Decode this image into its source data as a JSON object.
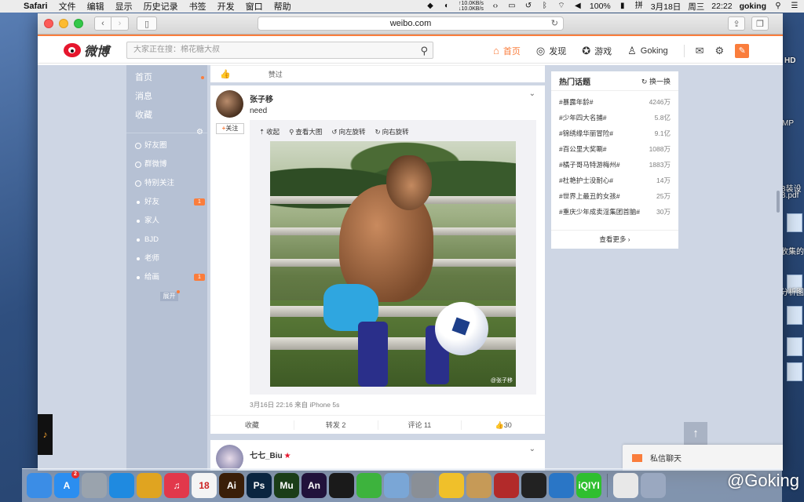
{
  "menubar": {
    "app": "Safari",
    "items": [
      "文件",
      "编辑",
      "显示",
      "历史记录",
      "书签",
      "开发",
      "窗口",
      "帮助"
    ],
    "net_up": "10.0KB/s",
    "net_down": "10.0KB/s",
    "battery": "100%",
    "date": "3月18日",
    "weekday": "周三",
    "time": "22:22",
    "user": "goking"
  },
  "browser": {
    "url": "weibo.com"
  },
  "weibo": {
    "logo_text": "微博",
    "search_placeholder": "大家正在搜：棉花糖大叔",
    "nav": [
      {
        "label": "首页",
        "icon": "home-icon"
      },
      {
        "label": "发现",
        "icon": "compass-icon"
      },
      {
        "label": "游戏",
        "icon": "game-icon"
      },
      {
        "label": "Goking",
        "icon": "user-icon"
      }
    ]
  },
  "left_nav": {
    "main": [
      "首页",
      "消息",
      "收藏"
    ],
    "groups": [
      {
        "label": "好友圈",
        "badge": ""
      },
      {
        "label": "群微博",
        "badge": ""
      },
      {
        "label": "特别关注",
        "badge": ""
      },
      {
        "label": "好友",
        "badge": "1"
      },
      {
        "label": "家人",
        "badge": ""
      },
      {
        "label": "BJD",
        "badge": ""
      },
      {
        "label": "老师",
        "badge": ""
      },
      {
        "label": "给画",
        "badge": "1"
      }
    ],
    "expand": "展开"
  },
  "feed": {
    "prev_like_label": "赞过",
    "post": {
      "author": "张子移",
      "text": "need",
      "follow_label": "关注",
      "tools": [
        "收起",
        "查看大图",
        "向左旋转",
        "向右旋转"
      ],
      "watermark": "@张子移",
      "meta": "3月16日 22:16 来自 iPhone 5s",
      "actions": {
        "collect": "收藏",
        "repost": "转发 2",
        "comment": "评论 11",
        "like": "30"
      }
    },
    "next_post": {
      "author": "七七_Biu"
    }
  },
  "hot_topics": {
    "title": "热门话题",
    "refresh": "换一换",
    "items": [
      {
        "topic": "#暴露年龄#",
        "count": "4246万"
      },
      {
        "topic": "#少年四大名捕#",
        "count": "5.8亿"
      },
      {
        "topic": "#锦绣缘华丽冒险#",
        "count": "9.1亿"
      },
      {
        "topic": "#百公里大奖唰#",
        "count": "1088万"
      },
      {
        "topic": "#橘子哥马特游梅州#",
        "count": "1883万"
      },
      {
        "topic": "#杜艳护士没耐心#",
        "count": "14万"
      },
      {
        "topic": "#世界上最丑的女孩#",
        "count": "25万"
      },
      {
        "topic": "#重庆少年成卖淫集团首脑#",
        "count": "30万"
      }
    ],
    "more": "查看更多"
  },
  "chat": {
    "label": "私信聊天"
  },
  "desktop": {
    "labels": [
      "HD",
      "MP",
      "B装设",
      "B.pdf",
      "收集的",
      "分析图"
    ],
    "watermark": "@Goking"
  },
  "dock": {
    "apps": [
      {
        "name": "finder-icon",
        "label": "",
        "color": "#3b8de6"
      },
      {
        "name": "app-store-icon",
        "label": "A",
        "color": "#2b8ef0",
        "badge": "2"
      },
      {
        "name": "launchpad-icon",
        "label": "",
        "color": "#9aa3ad"
      },
      {
        "name": "safari-icon",
        "label": "",
        "color": "#1f8ae0"
      },
      {
        "name": "chrome-icon",
        "label": "",
        "color": "#e0a420"
      },
      {
        "name": "itunes-icon",
        "label": "♫",
        "color": "#e2384b"
      },
      {
        "name": "calendar-icon",
        "label": "18",
        "color": "#f4f4f4"
      },
      {
        "name": "illustrator-icon",
        "label": "Ai",
        "color": "#3a1e08"
      },
      {
        "name": "photoshop-icon",
        "label": "Ps",
        "color": "#0a2540"
      },
      {
        "name": "muse-icon",
        "label": "Mu",
        "color": "#1b3d18"
      },
      {
        "name": "animate-icon",
        "label": "An",
        "color": "#21123b"
      },
      {
        "name": "qq-icon",
        "label": "",
        "color": "#1a1a1a"
      },
      {
        "name": "wechat-icon",
        "label": "",
        "color": "#3db33d"
      },
      {
        "name": "preview-icon",
        "label": "",
        "color": "#7aa6d6"
      },
      {
        "name": "system-preferences-icon",
        "label": "",
        "color": "#8a8f96"
      },
      {
        "name": "photos-icon",
        "label": "",
        "color": "#f0c02a"
      },
      {
        "name": "photo-browser-icon",
        "label": "",
        "color": "#c69a57"
      },
      {
        "name": "photo-booth-icon",
        "label": "",
        "color": "#b22a2a"
      },
      {
        "name": "activity-monitor-icon",
        "label": "",
        "color": "#222"
      },
      {
        "name": "xcode-icon",
        "label": "",
        "color": "#2a76c6"
      },
      {
        "name": "iqiyi-icon",
        "label": "iQIYI",
        "color": "#2fbf2f"
      },
      {
        "name": "document-icon",
        "label": "",
        "color": "#e8e8e8"
      },
      {
        "name": "downloads-icon",
        "label": "",
        "color": "#9aa8c0"
      }
    ]
  }
}
